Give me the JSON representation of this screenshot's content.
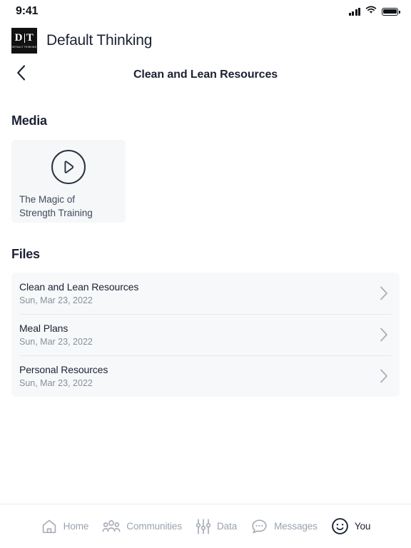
{
  "status_bar": {
    "time": "9:41",
    "signal_icon": "cellular-signal-icon",
    "wifi_icon": "wifi-icon",
    "battery_icon": "battery-icon"
  },
  "brand": {
    "logo_mark": "DT",
    "logo_letter_left": "D",
    "logo_letter_right": "T",
    "logo_subtext": "DEFAULT THINKING",
    "name": "Default Thinking"
  },
  "navbar": {
    "back_icon": "chevron-left-icon",
    "title": "Clean and Lean Resources"
  },
  "media": {
    "heading": "Media",
    "items": [
      {
        "play_icon": "play-circle-icon",
        "title_line1": "The Magic of",
        "title_line2": "Strength Training"
      }
    ]
  },
  "files": {
    "heading": "Files",
    "chevron_icon": "chevron-right-icon",
    "items": [
      {
        "name": "Clean and Lean Resources",
        "date": "Sun, Mar 23, 2022"
      },
      {
        "name": "Meal Plans",
        "date": "Sun, Mar 23, 2022"
      },
      {
        "name": "Personal Resources",
        "date": "Sun, Mar 23, 2022"
      }
    ]
  },
  "tabbar": {
    "items": [
      {
        "label": "Home",
        "icon": "home-icon",
        "active": false
      },
      {
        "label": "Communities",
        "icon": "people-group-icon",
        "active": false
      },
      {
        "label": "Data",
        "icon": "sliders-icon",
        "active": false
      },
      {
        "label": "Messages",
        "icon": "chat-bubble-icon",
        "active": false
      },
      {
        "label": "You",
        "icon": "smiley-face-icon",
        "active": true
      }
    ]
  },
  "colors": {
    "text_primary": "#1b2233",
    "text_muted": "#878f9c",
    "tab_inactive": "#9aa2af",
    "card_bg": "#f5f7f9",
    "list_bg": "#f7f8fa",
    "divider": "#e6e9ed",
    "logo_bg": "#111111"
  }
}
